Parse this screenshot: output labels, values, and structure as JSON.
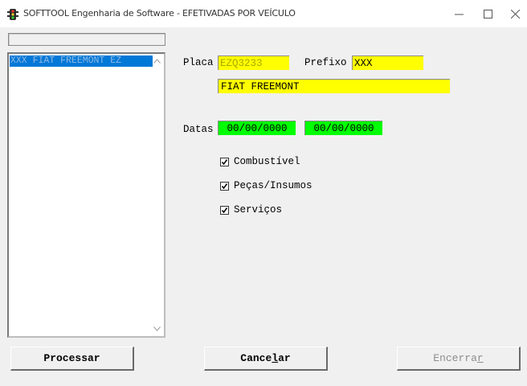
{
  "window": {
    "title": "SOFTTOOL Engenharia de Software - EFETIVADAS POR VEÍCULO",
    "icon": "traffic-light-icon",
    "controls": [
      "minimize-icon",
      "maximize-icon",
      "close-icon"
    ]
  },
  "list": {
    "items": [
      "XXX FIAT FREEMONT EZ"
    ],
    "selected_index": 0
  },
  "form": {
    "placa_label": "Placa",
    "placa_value": "EZQ3233",
    "prefixo_label": "Prefixo",
    "prefixo_value": "XXX",
    "description_value": "FIAT FREEMONT",
    "datas_label": "Datas",
    "date_start": "00/00/0000",
    "date_end": "00/00/0000"
  },
  "options": [
    {
      "label": "Combustível",
      "checked": true
    },
    {
      "label": "Peças/Insumos",
      "checked": true
    },
    {
      "label": "Serviços",
      "checked": true
    }
  ],
  "buttons": {
    "processar": "Processar",
    "cancelar_prefix": "Cance",
    "cancelar_accel": "l",
    "cancelar_suffix": "ar",
    "encerrar_prefix": "Encerra",
    "encerrar_accel": "r"
  },
  "colors": {
    "field_yellow": "#ffff00",
    "field_green": "#00ff00",
    "selection_blue": "#0078d7",
    "placa_text": "#a8a800"
  }
}
